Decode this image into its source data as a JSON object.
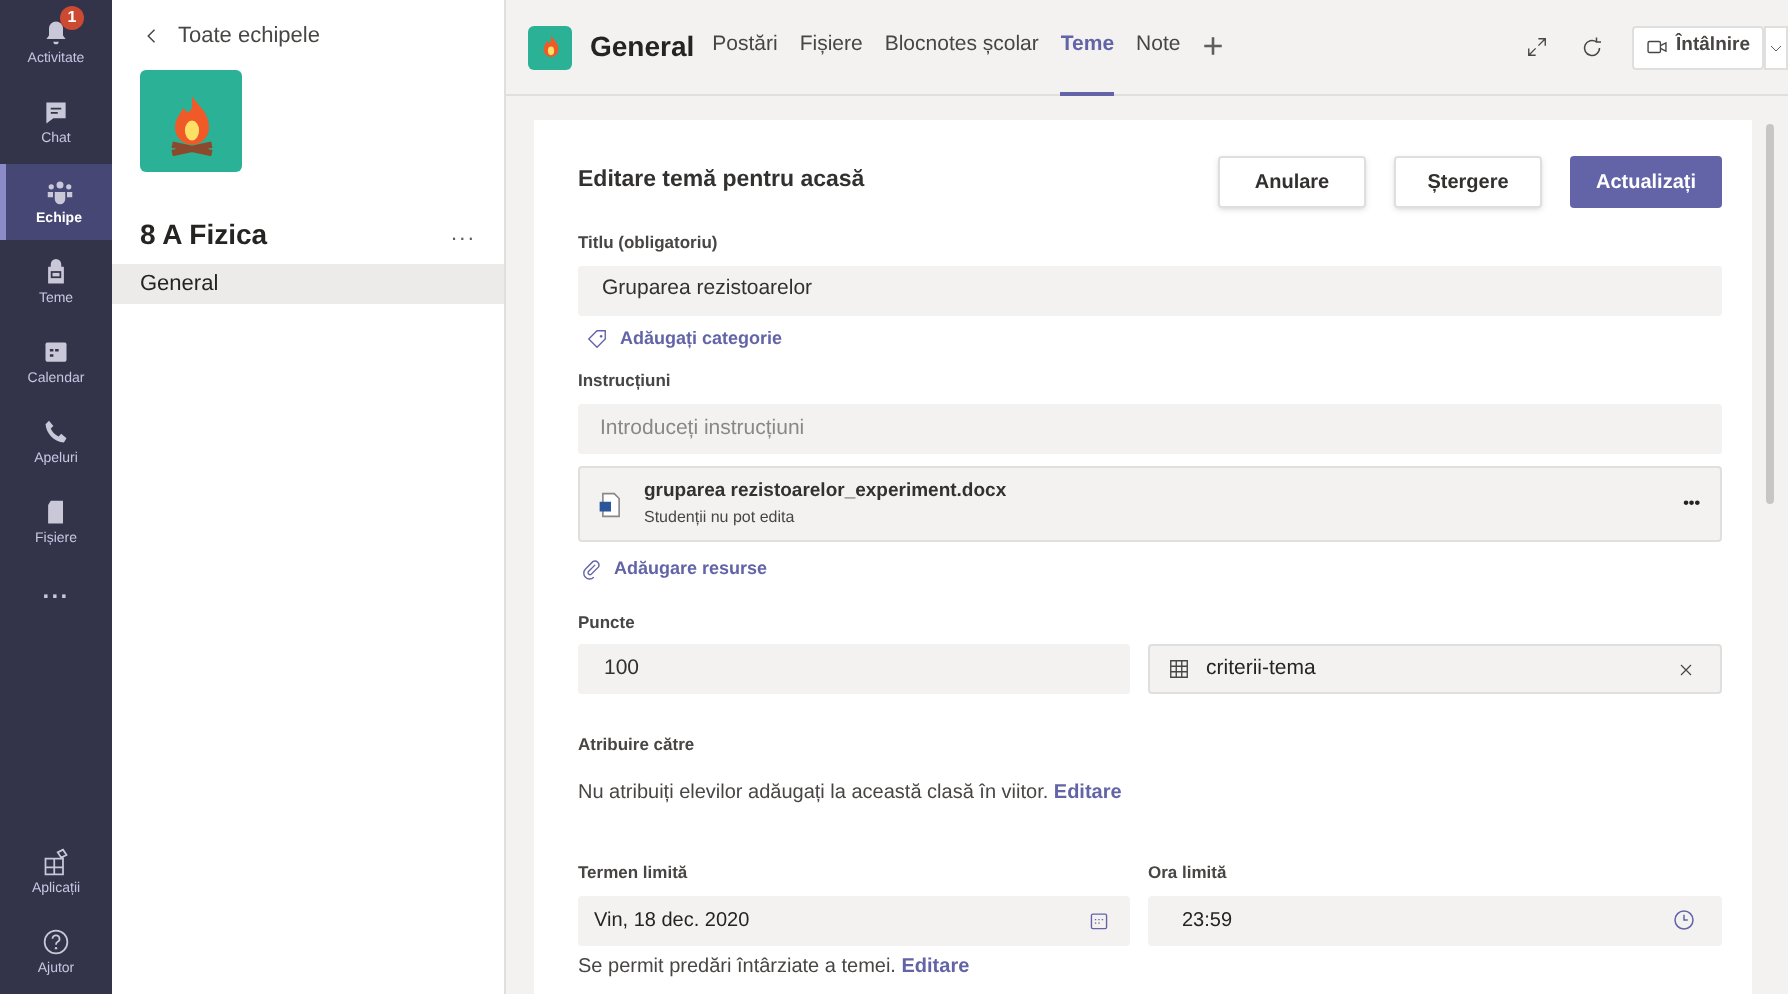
{
  "rail": {
    "items": [
      {
        "label": "Activitate",
        "kind": "bell",
        "badge": "1",
        "selected": false
      },
      {
        "label": "Chat",
        "kind": "chat",
        "selected": false
      },
      {
        "label": "Echipe",
        "kind": "teams",
        "selected": true
      },
      {
        "label": "Teme",
        "kind": "bag",
        "selected": false
      },
      {
        "label": "Calendar",
        "kind": "calendar",
        "selected": false
      },
      {
        "label": "Apeluri",
        "kind": "phone",
        "selected": false
      },
      {
        "label": "Fișiere",
        "kind": "file",
        "selected": false
      }
    ],
    "more": "...",
    "bottom": [
      {
        "label": "Aplicații",
        "kind": "apps",
        "selected": false
      },
      {
        "label": "Ajutor",
        "kind": "help",
        "selected": false
      }
    ]
  },
  "team_panel": {
    "back": "Toate echipele",
    "team_name": "8 A Fizica",
    "more": "...",
    "channels": [
      {
        "label": "General",
        "selected": true
      }
    ]
  },
  "header": {
    "channel": "General",
    "tabs": [
      {
        "label": "Postări",
        "selected": false
      },
      {
        "label": "Fișiere",
        "selected": false
      },
      {
        "label": "Blocnotes școlar",
        "selected": false
      },
      {
        "label": "Teme",
        "selected": true
      },
      {
        "label": "Note",
        "selected": false
      }
    ],
    "add": "+",
    "meet": "Întâlnire"
  },
  "form": {
    "title": "Editare temă pentru acasă",
    "buttons": [
      {
        "label": "Anulare",
        "primary": false
      },
      {
        "label": "Ștergere",
        "primary": false
      },
      {
        "label": "Actualizați",
        "primary": true
      }
    ],
    "title_label": "Titlu (obligatoriu)",
    "title_value": "Gruparea rezistoarelor",
    "add_category": "Adăugați categorie",
    "instructions_label": "Instrucțiuni",
    "instructions_placeholder": "Introduceți instrucțiuni",
    "attachment": {
      "name": "gruparea rezistoarelor_experiment.docx",
      "note": "Studenții nu pot edita",
      "more": "•••"
    },
    "add_resources": "Adăugare resurse",
    "points_label": "Puncte",
    "points_value": "100",
    "rubric": "criterii-tema",
    "assign_label": "Atribuire către",
    "assign_text": "Nu atribuiți elevilor adăugați la această clasă în viitor.",
    "assign_link": "Editare",
    "due_label": "Termen limită",
    "due_value": "Vin, 18 dec. 2020",
    "time_label": "Ora limită",
    "time_value": "23:59",
    "late_text": "Se permit predări întârziate a temei.",
    "late_link": "Editare"
  }
}
